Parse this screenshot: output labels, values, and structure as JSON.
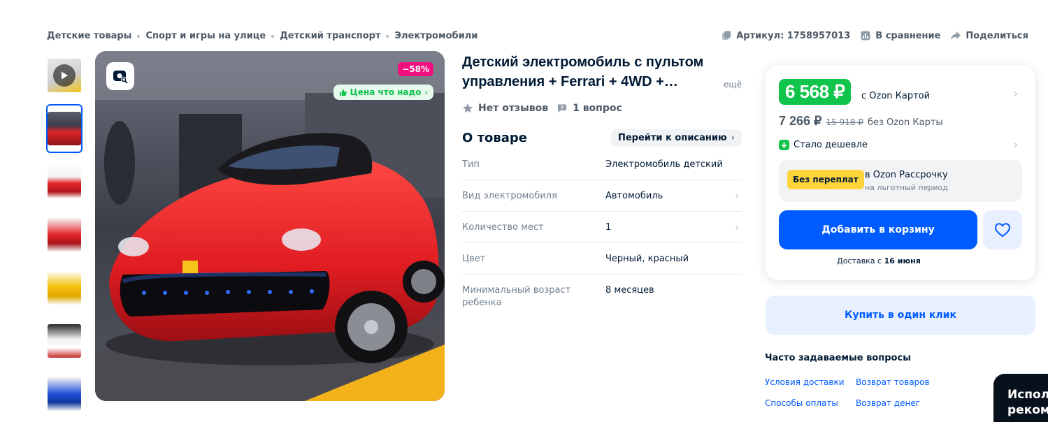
{
  "breadcrumbs": [
    "Детские товары",
    "Спорт и игры на улице",
    "Детский транспорт",
    "Электромобили"
  ],
  "top_actions": {
    "article": "Артикул: 1758957013",
    "compare": "В сравнение",
    "share": "Поделиться"
  },
  "gallery": {
    "thumbnails": [
      {
        "kind": "video",
        "color": "#f0c419"
      },
      {
        "kind": "image",
        "color": "#e3262b",
        "active": true
      },
      {
        "kind": "image",
        "color": "#e3262b"
      },
      {
        "kind": "image",
        "color": "#e3262b"
      },
      {
        "kind": "image",
        "color": "#f4c20d"
      },
      {
        "kind": "image",
        "color": "#f2f2f2"
      },
      {
        "kind": "image",
        "color": "#1f4fd8"
      }
    ],
    "discount": "−58%",
    "price_tag": "Цена что надо"
  },
  "product": {
    "title": "Детский электромобиль с пультом управления + Ferrari + 4WD +…",
    "more": "ещё",
    "reviews": "Нет отзывов",
    "questions": "1 вопрос"
  },
  "about": {
    "heading": "О товаре",
    "goto_label": "Перейти к описанию",
    "specs": [
      {
        "key": "Тип",
        "value": "Электромобиль детский",
        "link": false
      },
      {
        "key": "Вид электромобиля",
        "value": "Автомобиль",
        "link": true
      },
      {
        "key": "Количество мест",
        "value": "1",
        "link": true
      },
      {
        "key": "Цвет",
        "value": "Черный, красный",
        "link": false
      },
      {
        "key": "Минимальный возраст ребенка",
        "value": "8 месяцев",
        "link": false
      }
    ]
  },
  "buy": {
    "price_card": "6 568 ₽",
    "price_card_note": "с Ozon Картой",
    "price_regular": "7 266 ₽",
    "price_old": "15 918 ₽",
    "price_regular_note": "без Ozon Карты",
    "cheaper": "Стало дешевле",
    "installment_tag": "Без переплат",
    "installment_title": "в Ozon Рассрочку",
    "installment_sub": "на льготный период",
    "add_to_cart": "Добавить в корзину",
    "delivery_prefix": "Доставка с",
    "delivery_date": "16 июня",
    "one_click": "Купить в один клик"
  },
  "faq": {
    "title": "Часто задаваемые вопросы",
    "links": [
      "Условия доставки",
      "Возврат товаров",
      "Способы оплаты",
      "Возврат денег"
    ]
  },
  "promo": {
    "line1": "Испол",
    "line2": "реком"
  },
  "colors": {
    "accent": "#005bff",
    "price_green": "#10c44c",
    "discount_pink": "#f1117e",
    "installment_yellow": "#ffd43b"
  }
}
